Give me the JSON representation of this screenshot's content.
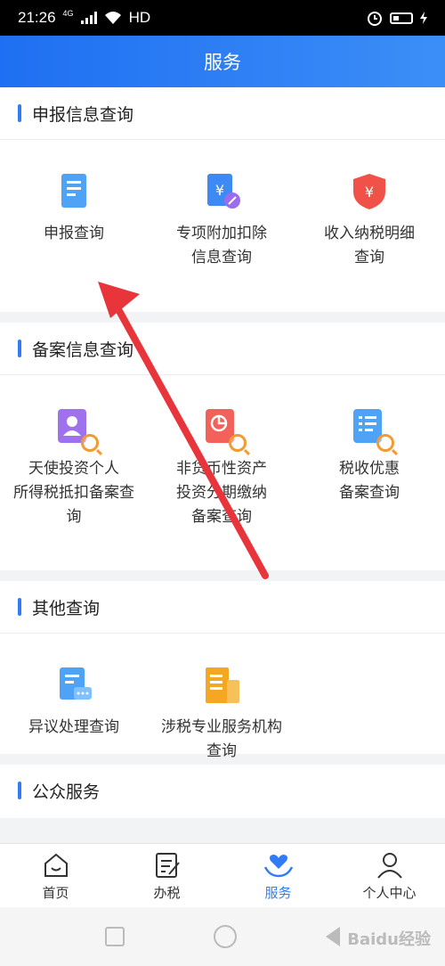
{
  "status_bar": {
    "time": "21:26",
    "network": "4G",
    "hd": "HD"
  },
  "header": {
    "title": "服务"
  },
  "sections": [
    {
      "title": "申报信息查询",
      "items": [
        {
          "lines": [
            "申报查询"
          ]
        },
        {
          "lines": [
            "专项附加扣除",
            "信息查询"
          ]
        },
        {
          "lines": [
            "收入纳税明细",
            "查询"
          ]
        }
      ]
    },
    {
      "title": "备案信息查询",
      "items": [
        {
          "lines": [
            "天使投资个人",
            "所得税抵扣备案查",
            "询"
          ]
        },
        {
          "lines": [
            "非货币性资产",
            "投资分期缴纳",
            "备案查询"
          ]
        },
        {
          "lines": [
            "税收优惠",
            "备案查询"
          ]
        }
      ]
    },
    {
      "title": "其他查询",
      "items": [
        {
          "lines": [
            "异议处理查询"
          ]
        },
        {
          "lines": [
            "涉税专业服务机构",
            "查询"
          ]
        }
      ]
    },
    {
      "title": "公众服务"
    }
  ],
  "tabs": [
    {
      "label": "首页",
      "icon": "home-icon"
    },
    {
      "label": "办税",
      "icon": "tax-form-icon"
    },
    {
      "label": "服务",
      "icon": "heart-hand-icon",
      "active": true
    },
    {
      "label": "个人中心",
      "icon": "person-icon"
    }
  ],
  "watermark": {
    "text": "Baidu经验"
  },
  "colors": {
    "accent": "#2f7cf6",
    "arrow": "#e8353b"
  }
}
